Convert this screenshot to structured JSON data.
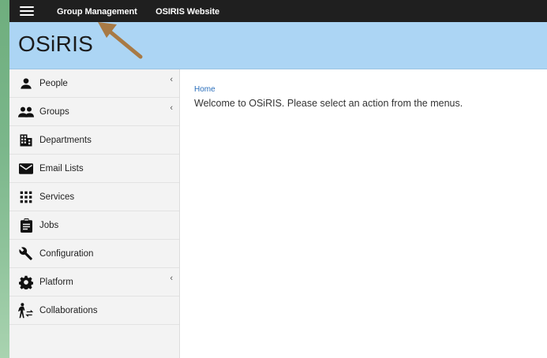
{
  "topbar": {
    "menu_icon": "hamburger-icon",
    "links": [
      "Group Management",
      "OSIRIS Website"
    ]
  },
  "header": {
    "brand": "OSiRIS",
    "background": "#acd5f4"
  },
  "sidebar": {
    "items": [
      {
        "label": "People",
        "icon": "person-icon",
        "has_submenu": true
      },
      {
        "label": "Groups",
        "icon": "group-icon",
        "has_submenu": true
      },
      {
        "label": "Departments",
        "icon": "building-icon",
        "has_submenu": false
      },
      {
        "label": "Email Lists",
        "icon": "mail-icon",
        "has_submenu": false
      },
      {
        "label": "Services",
        "icon": "grid-icon",
        "has_submenu": false
      },
      {
        "label": "Jobs",
        "icon": "clipboard-icon",
        "has_submenu": false
      },
      {
        "label": "Configuration",
        "icon": "wrench-icon",
        "has_submenu": false
      },
      {
        "label": "Platform",
        "icon": "gear-icon",
        "has_submenu": true
      },
      {
        "label": "Collaborations",
        "icon": "transfer-person-icon",
        "has_submenu": false
      }
    ],
    "chevron": "‹"
  },
  "main": {
    "breadcrumb": "Home",
    "welcome": "Welcome to OSiRIS. Please select an action from the menus."
  },
  "annotation": {
    "arrow_color": "#a87a45"
  }
}
